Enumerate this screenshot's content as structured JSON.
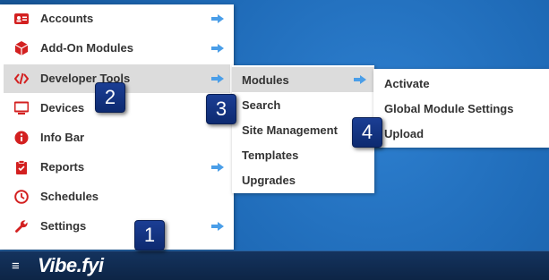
{
  "menu": {
    "items": [
      {
        "label": "Accounts",
        "icon": "id-card-icon",
        "has_submenu": true
      },
      {
        "label": "Add-On Modules",
        "icon": "cube-icon",
        "has_submenu": true
      },
      {
        "label": "Developer Tools",
        "icon": "code-icon",
        "has_submenu": true,
        "active": true
      },
      {
        "label": "Devices",
        "icon": "monitor-icon",
        "has_submenu": false
      },
      {
        "label": "Info Bar",
        "icon": "info-circle-icon",
        "has_submenu": false
      },
      {
        "label": "Reports",
        "icon": "clipboard-check-icon",
        "has_submenu": true
      },
      {
        "label": "Schedules",
        "icon": "clock-icon",
        "has_submenu": false
      },
      {
        "label": "Settings",
        "icon": "wrench-icon",
        "has_submenu": true
      }
    ]
  },
  "submenu_developer": {
    "items": [
      {
        "label": "Modules",
        "has_submenu": true,
        "active": true
      },
      {
        "label": "Search"
      },
      {
        "label": "Site Management"
      },
      {
        "label": "Templates"
      },
      {
        "label": "Upgrades"
      }
    ]
  },
  "submenu_modules": {
    "items": [
      {
        "label": "Activate"
      },
      {
        "label": "Global Module Settings"
      },
      {
        "label": "Upload"
      }
    ]
  },
  "callouts": [
    "1",
    "2",
    "3",
    "4"
  ],
  "taskbar": {
    "menu_glyph": "≡",
    "logo": "Vibe.fyi"
  },
  "colors": {
    "icon_red": "#d32020",
    "arrow_blue": "#4a9ee8",
    "highlight": "#dcdcdc",
    "desktop": "#1f6bb8",
    "taskbar": "#0d2546"
  }
}
